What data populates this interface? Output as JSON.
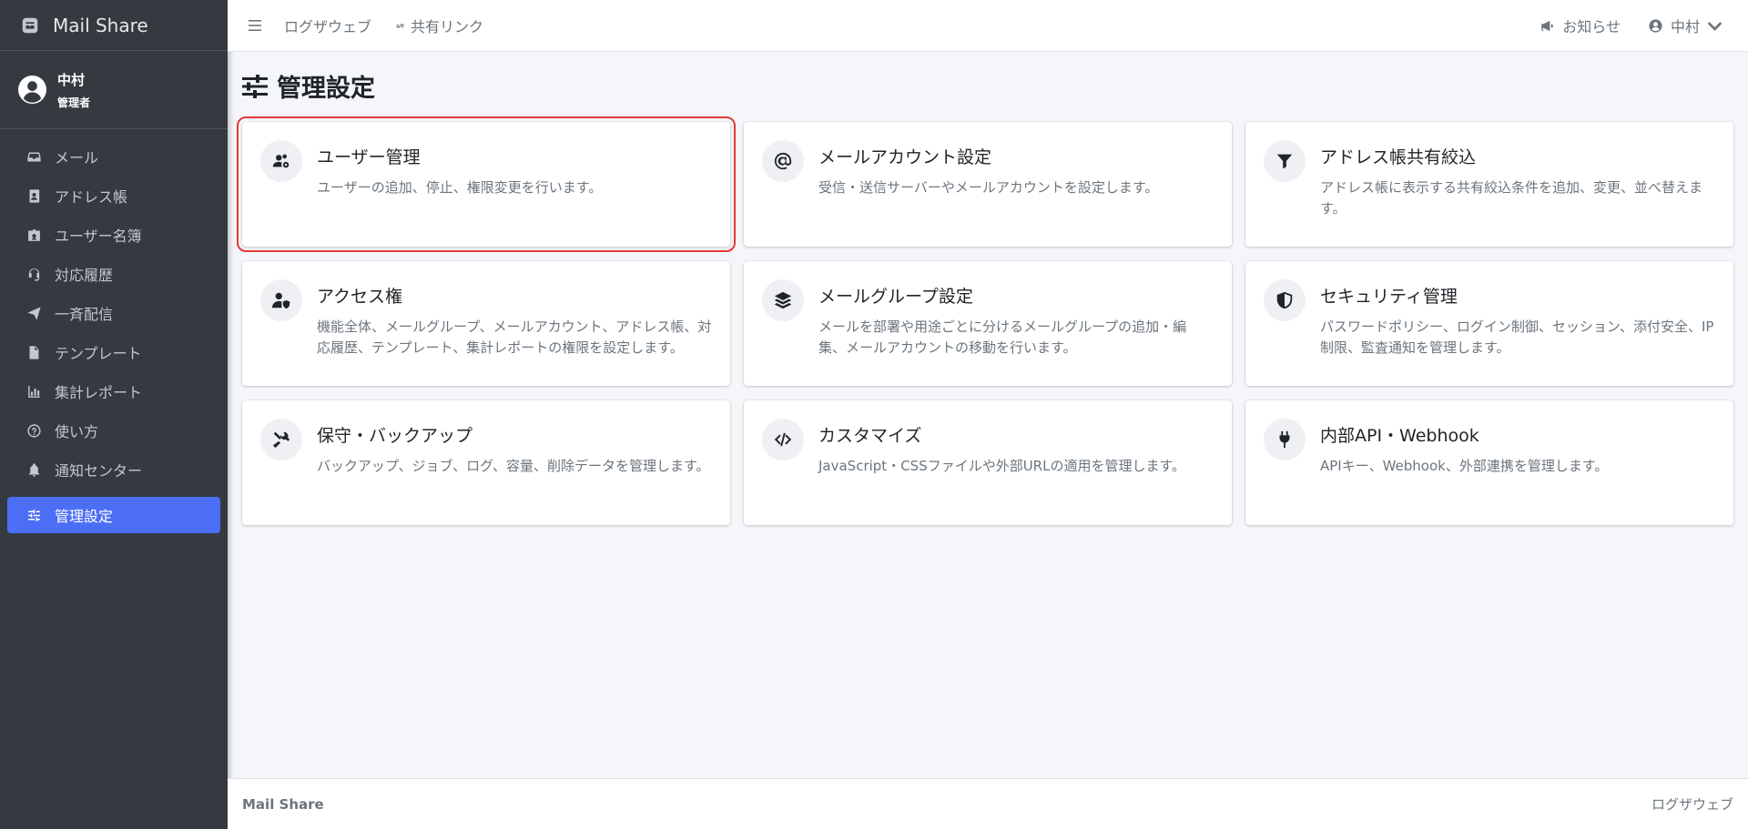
{
  "app": {
    "brand": "Mail Share"
  },
  "user": {
    "name": "中村",
    "role": "管理者"
  },
  "sidebar": {
    "items": [
      {
        "label": "メール",
        "icon": "inbox-icon"
      },
      {
        "label": "アドレス帳",
        "icon": "address-book-icon"
      },
      {
        "label": "ユーザー名簿",
        "icon": "id-badge-icon"
      },
      {
        "label": "対応履歴",
        "icon": "headset-icon"
      },
      {
        "label": "一斉配信",
        "icon": "paper-plane-icon"
      },
      {
        "label": "テンプレート",
        "icon": "file-icon"
      },
      {
        "label": "集計レポート",
        "icon": "bar-chart-icon"
      },
      {
        "label": "使い方",
        "icon": "question-circle-icon"
      },
      {
        "label": "通知センター",
        "icon": "bell-icon"
      },
      {
        "label": "管理設定",
        "icon": "sliders-icon",
        "active": true
      }
    ]
  },
  "topbar": {
    "logs": "ログザウェブ",
    "share_link": "共有リンク",
    "notices": "お知らせ",
    "user_menu": "中村"
  },
  "page": {
    "title": "管理設定"
  },
  "cards": [
    {
      "title": "ユーザー管理",
      "desc": "ユーザーの追加、停止、権限変更を行います。",
      "icon": "users-gear-icon"
    },
    {
      "title": "メールアカウント設定",
      "desc": "受信・送信サーバーやメールアカウントを設定します。",
      "icon": "at-sign-icon"
    },
    {
      "title": "アドレス帳共有絞込",
      "desc": "アドレス帳に表示する共有絞込条件を追加、変更、並べ替えます。",
      "icon": "filter-icon"
    },
    {
      "title": "アクセス権",
      "desc": "機能全体、メールグループ、メールアカウント、アドレス帳、対応履歴、テンプレート、集計レポートの権限を設定します。",
      "icon": "user-shield-icon"
    },
    {
      "title": "メールグループ設定",
      "desc": "メールを部署や用途ごとに分けるメールグループの追加・編集、メールアカウントの移動を行います。",
      "icon": "layers-icon"
    },
    {
      "title": "セキュリティ管理",
      "desc": "パスワードポリシー、ログイン制御、セッション、添付安全、IP制限、監査通知を管理します。",
      "icon": "shield-icon"
    },
    {
      "title": "保守・バックアップ",
      "desc": "バックアップ、ジョブ、ログ、容量、削除データを管理します。",
      "icon": "tools-icon"
    },
    {
      "title": "カスタマイズ",
      "desc": "JavaScript・CSSファイルや外部URLの適用を管理します。",
      "icon": "code-icon"
    },
    {
      "title": "内部API・Webhook",
      "desc": "APIキー、Webhook、外部連携を管理します。",
      "icon": "plug-icon"
    }
  ],
  "footer": {
    "brand": "Mail Share",
    "right": "ログザウェブ"
  },
  "colors": {
    "sidebar_bg": "#343a40",
    "active": "#4c6ef5",
    "highlight": "#e53935"
  }
}
